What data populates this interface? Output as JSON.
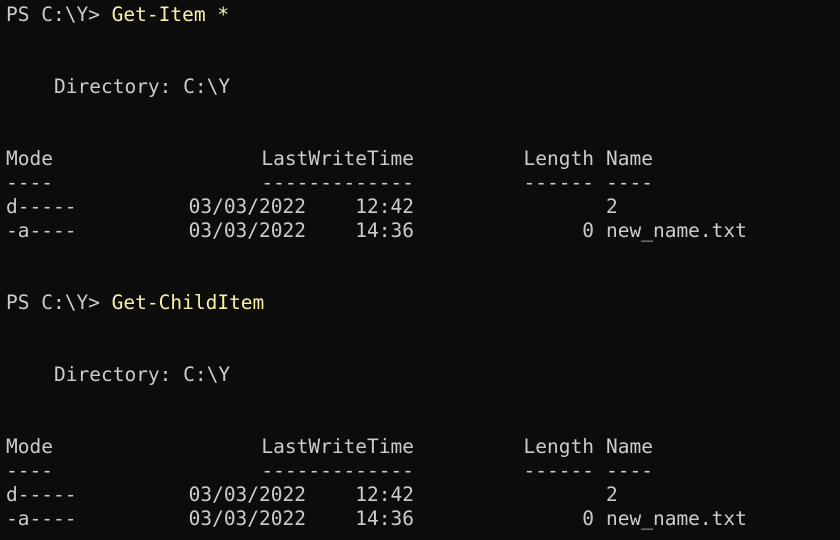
{
  "blocks": [
    {
      "prompt": "PS C:\\Y> ",
      "command": "Get-Item *",
      "directory_label": "Directory: C:\\Y",
      "headers": {
        "mode": "Mode",
        "last_write_time": "LastWriteTime",
        "length": "Length",
        "name": "Name"
      },
      "separators": {
        "mode": "----",
        "last_write_time": "-------------",
        "length": "------",
        "name": "----"
      },
      "rows": [
        {
          "mode": "d-----",
          "date": "03/03/2022",
          "time": "12:42",
          "length": "",
          "name": "2"
        },
        {
          "mode": "-a----",
          "date": "03/03/2022",
          "time": "14:36",
          "length": "0",
          "name": "new_name.txt"
        }
      ]
    },
    {
      "prompt": "PS C:\\Y> ",
      "command": "Get-ChildItem",
      "directory_label": "Directory: C:\\Y",
      "headers": {
        "mode": "Mode",
        "last_write_time": "LastWriteTime",
        "length": "Length",
        "name": "Name"
      },
      "separators": {
        "mode": "----",
        "last_write_time": "-------------",
        "length": "------",
        "name": "----"
      },
      "rows": [
        {
          "mode": "d-----",
          "date": "03/03/2022",
          "time": "12:42",
          "length": "",
          "name": "2"
        },
        {
          "mode": "-a----",
          "date": "03/03/2022",
          "time": "14:36",
          "length": "0",
          "name": "new_name.txt"
        }
      ]
    }
  ],
  "colors": {
    "background": "#0c0c0c",
    "foreground": "#cccccc",
    "command": "#f9f1a5"
  }
}
